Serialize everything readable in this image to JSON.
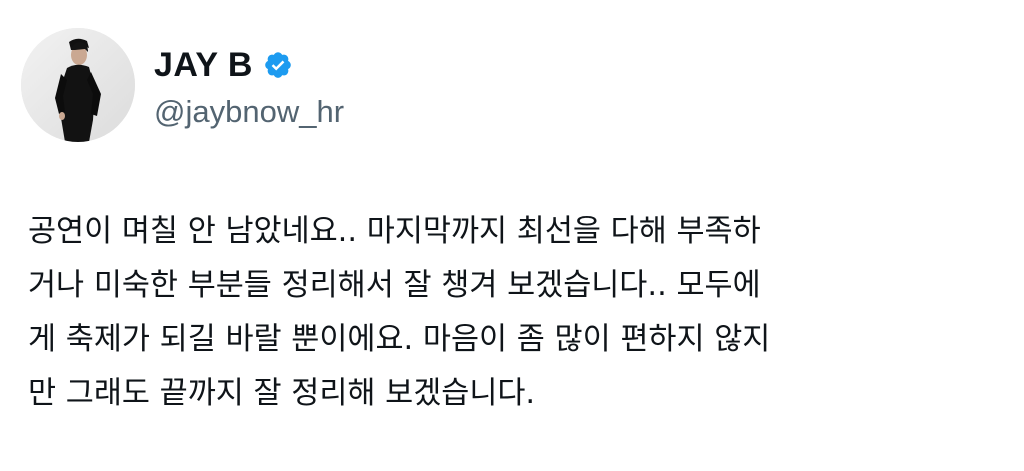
{
  "author": {
    "display_name": "JAY B",
    "handle": "@jaybnow_hr",
    "verified": true,
    "avatar_icon": "profile-photo",
    "verified_icon": "verified-badge-icon",
    "verified_color": "#1d9bf0"
  },
  "tweet": {
    "lines": [
      "공연이 며칠 안 남았네요.. 마지막까지 최선을 다해 부족하",
      "거나 미숙한 부분들 정리해서 잘 챙겨 보겠습니다.. 모두에",
      "게 축제가 되길 바랄 뿐이에요. 마음이 좀 많이 편하지 않지",
      "만 그래도 끝까지 잘 정리해 보겠습니다."
    ]
  },
  "colors": {
    "text": "#0f1419",
    "secondary": "#536471",
    "background": "#ffffff"
  }
}
